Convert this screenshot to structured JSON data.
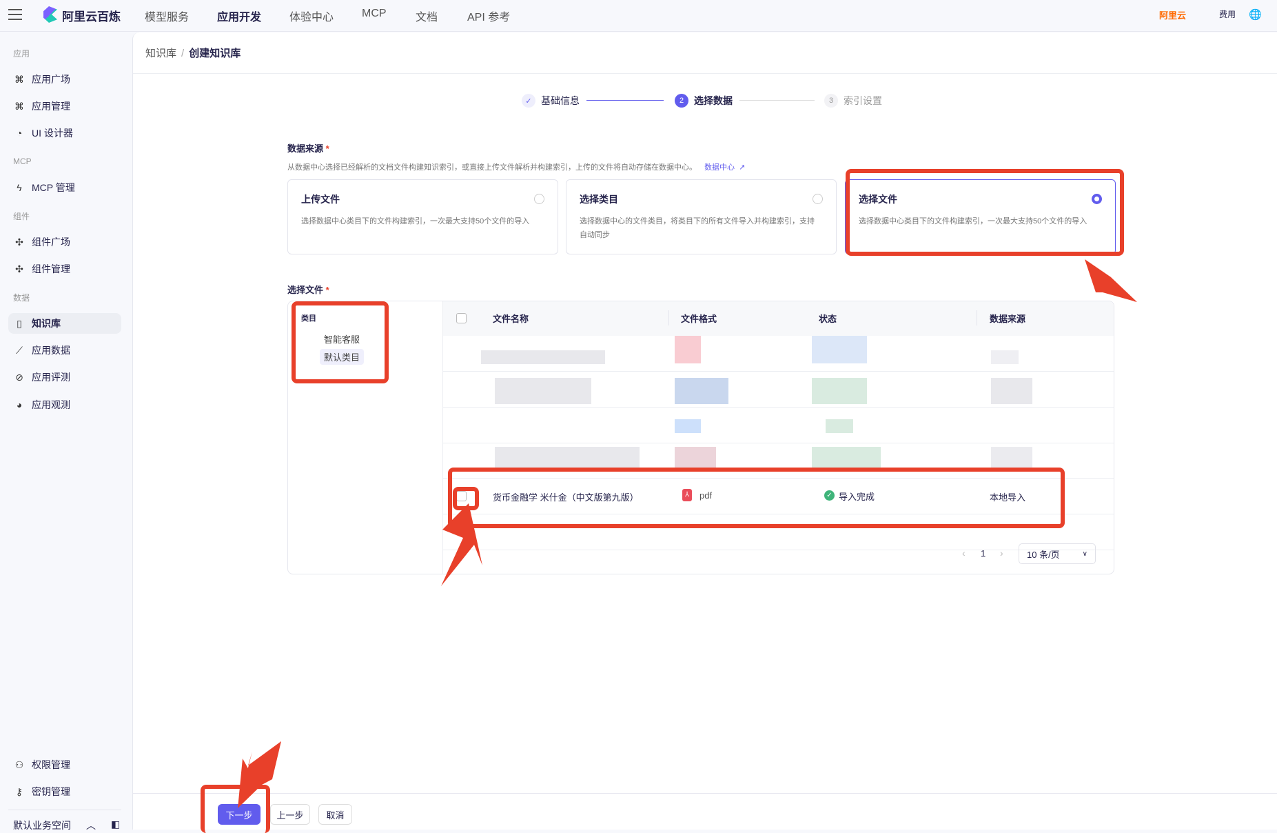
{
  "header": {
    "brand": "阿里云百炼",
    "nav": [
      "模型服务",
      "应用开发",
      "体验中心",
      "MCP",
      "文档",
      "API 参考"
    ],
    "aliyun": "阿里云",
    "fees": "费用"
  },
  "sidebar": {
    "sections": [
      {
        "title": "应用",
        "items": [
          "应用广场",
          "应用管理",
          "UI 设计器"
        ]
      },
      {
        "title": "MCP",
        "items": [
          "MCP 管理"
        ]
      },
      {
        "title": "组件",
        "items": [
          "组件广场",
          "组件管理"
        ]
      },
      {
        "title": "数据",
        "items": [
          "知识库",
          "应用数据",
          "应用评测",
          "应用观测"
        ]
      }
    ],
    "bottom": [
      "权限管理",
      "密钥管理"
    ],
    "workspace": "默认业务空间"
  },
  "breadcrumb": {
    "parent": "知识库",
    "current": "创建知识库"
  },
  "steps": [
    {
      "num": "✓",
      "label": "基础信息"
    },
    {
      "num": "2",
      "label": "选择数据"
    },
    {
      "num": "3",
      "label": "索引设置"
    }
  ],
  "source": {
    "label": "数据来源",
    "desc": "从数据中心选择已经解析的文档文件构建知识索引，或直接上传文件解析并构建索引，上传的文件将自动存储在数据中心。",
    "link": "数据中心",
    "options": [
      {
        "title": "上传文件",
        "desc": "选择数据中心类目下的文件构建索引，一次最大支持50个文件的导入"
      },
      {
        "title": "选择类目",
        "desc": "选择数据中心的文件类目，将类目下的所有文件导入并构建索引，支持自动同步"
      },
      {
        "title": "选择文件",
        "desc": "选择数据中心类目下的文件构建索引，一次最大支持50个文件的导入"
      }
    ]
  },
  "files": {
    "label": "选择文件",
    "category_label": "类目",
    "categories": [
      "智能客服",
      "默认类目"
    ],
    "columns": [
      "文件名称",
      "文件格式",
      "状态",
      "数据来源"
    ],
    "row": {
      "name": "货币金融学 米什金（中文版第九版）",
      "format": "pdf",
      "status": "导入完成",
      "source": "本地导入"
    },
    "page": "1",
    "page_size": "10 条/页"
  },
  "footer": {
    "next": "下一步",
    "prev": "上一步",
    "cancel": "取消"
  },
  "colors": {
    "accent": "#615ced",
    "annotation": "#e8402a"
  }
}
